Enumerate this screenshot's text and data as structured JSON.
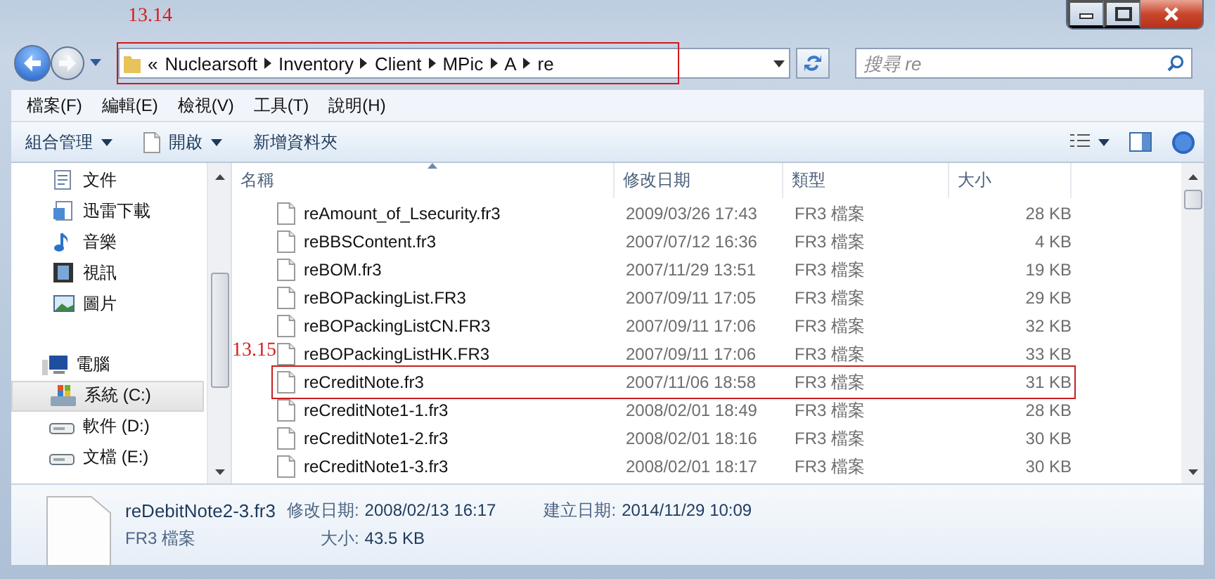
{
  "address_bar": {
    "annotation": "13.14",
    "crumbs": [
      "«",
      "Nuclearsoft",
      "Inventory",
      "Client",
      "MPic",
      "A",
      "re"
    ]
  },
  "search": {
    "placeholder": "搜尋 re"
  },
  "menu": [
    "檔案(F)",
    "編輯(E)",
    "檢視(V)",
    "工具(T)",
    "說明(H)"
  ],
  "commands": [
    {
      "label": "組合管理",
      "kind": "dropdown"
    },
    {
      "label": "開啟",
      "kind": "file-dropdown"
    },
    {
      "label": "新增資料夾",
      "kind": "plain"
    }
  ],
  "nav": {
    "items": [
      {
        "label": "文件",
        "kind": "documents",
        "selected": false
      },
      {
        "label": "迅雷下載",
        "kind": "download",
        "selected": false
      },
      {
        "label": "音樂",
        "kind": "music",
        "selected": false
      },
      {
        "label": "視訊",
        "kind": "video",
        "selected": false
      },
      {
        "label": "圖片",
        "kind": "pictures",
        "selected": false
      },
      {
        "label": "電腦",
        "kind": "computer",
        "selected": false,
        "children": [
          {
            "label": "系統 (C:)",
            "kind": "system-drive",
            "selected": true
          },
          {
            "label": "軟件 (D:)",
            "kind": "drive",
            "selected": false
          },
          {
            "label": "文檔 (E:)",
            "kind": "drive",
            "selected": false
          }
        ]
      }
    ]
  },
  "table": {
    "columns": [
      {
        "label": "名稱",
        "sorted": true
      },
      {
        "label": "修改日期",
        "sorted": false
      },
      {
        "label": "類型",
        "sorted": false
      },
      {
        "label": "大小",
        "sorted": false
      }
    ],
    "rows": [
      {
        "name": "reAmount_of_Lsecurity.fr3",
        "date": "2009/03/26 17:43",
        "type": "FR3 檔案",
        "size": "28 KB"
      },
      {
        "name": "reBBSContent.fr3",
        "date": "2007/07/12 16:36",
        "type": "FR3 檔案",
        "size": "4 KB"
      },
      {
        "name": "reBOM.fr3",
        "date": "2007/11/29 13:51",
        "type": "FR3 檔案",
        "size": "19 KB"
      },
      {
        "name": "reBOPackingList.FR3",
        "date": "2007/09/11 17:05",
        "type": "FR3 檔案",
        "size": "29 KB"
      },
      {
        "name": "reBOPackingListCN.FR3",
        "date": "2007/09/11 17:06",
        "type": "FR3 檔案",
        "size": "32 KB"
      },
      {
        "name": "reBOPackingListHK.FR3",
        "date": "2007/09/11 17:06",
        "type": "FR3 檔案",
        "size": "33 KB"
      },
      {
        "name": "reCreditNote.fr3",
        "date": "2007/11/06 18:58",
        "type": "FR3 檔案",
        "size": "31 KB",
        "annotation": "13.15"
      },
      {
        "name": "reCreditNote1-1.fr3",
        "date": "2008/02/01 18:49",
        "type": "FR3 檔案",
        "size": "28 KB"
      },
      {
        "name": "reCreditNote1-2.fr3",
        "date": "2008/02/01 18:16",
        "type": "FR3 檔案",
        "size": "30 KB"
      },
      {
        "name": "reCreditNote1-3.fr3",
        "date": "2008/02/01 18:17",
        "type": "FR3 檔案",
        "size": "30 KB"
      }
    ]
  },
  "details": {
    "name": "reDebitNote2-3.fr3",
    "type": "FR3 檔案",
    "fields": [
      {
        "label": "修改日期:",
        "value": "2008/02/13 16:17"
      },
      {
        "label": "建立日期:",
        "value": "2014/11/29 10:09"
      },
      {
        "label": "大小:",
        "value": "43.5 KB"
      }
    ]
  }
}
